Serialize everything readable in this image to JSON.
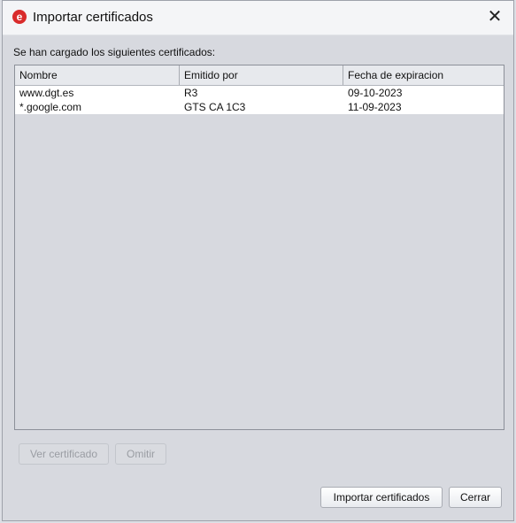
{
  "window": {
    "title": "Importar certificados",
    "close_glyph": "✕",
    "app_icon": "e"
  },
  "message": "Se han cargado los siguientes certificados:",
  "table": {
    "columns": [
      "Nombre",
      "Emitido por",
      "Fecha de expiracion"
    ],
    "rows": [
      [
        "www.dgt.es",
        "R3",
        "09-10-2023"
      ],
      [
        "*.google.com",
        "GTS CA 1C3",
        "11-09-2023"
      ]
    ]
  },
  "buttons": {
    "view": "Ver certificado",
    "skip": "Omitir",
    "import": "Importar certificados",
    "close": "Cerrar"
  }
}
